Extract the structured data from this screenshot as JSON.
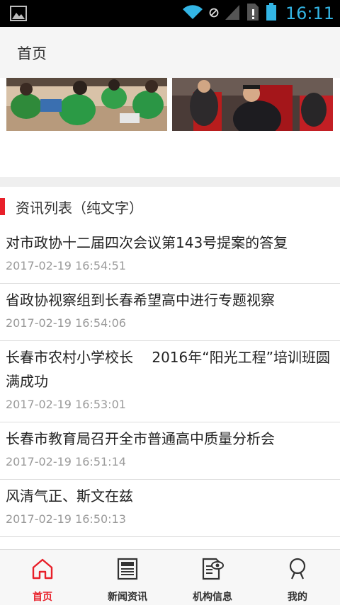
{
  "status_bar": {
    "time": "16:11",
    "icons": [
      "gallery-icon",
      "wifi-icon",
      "no-sim-icon",
      "signal-icon",
      "sim-alert-icon",
      "battery-icon"
    ],
    "accent_color": "#33b5e5"
  },
  "app_bar": {
    "title": "首页"
  },
  "section": {
    "title": "资讯列表（纯文字）",
    "accent_color": "#e8202a"
  },
  "news": [
    {
      "title": "对市政协十二届四次会议第143号提案的答复",
      "time": "2017-02-19 16:54:51"
    },
    {
      "title": "省政协视察组到长春希望高中进行专题视察",
      "time": "2017-02-19 16:54:06"
    },
    {
      "title": "长春市农村小学校长　 2016年“阳光工程”培训班圆满成功",
      "time": "2017-02-19 16:53:01"
    },
    {
      "title": "长春市教育局召开全市普通高中质量分析会",
      "time": "2017-02-19 16:51:14"
    },
    {
      "title": "风清气正、斯文在兹",
      "time": "2017-02-19 16:50:13"
    }
  ],
  "tabs": [
    {
      "label": "首页",
      "icon": "home-icon",
      "active": true
    },
    {
      "label": "新闻资讯",
      "icon": "newspaper-icon",
      "active": false
    },
    {
      "label": "机构信息",
      "icon": "document-eye-icon",
      "active": false
    },
    {
      "label": "我的",
      "icon": "user-icon",
      "active": false
    }
  ],
  "colors": {
    "active_tab": "#e8202a",
    "inactive_tab": "#333333"
  }
}
